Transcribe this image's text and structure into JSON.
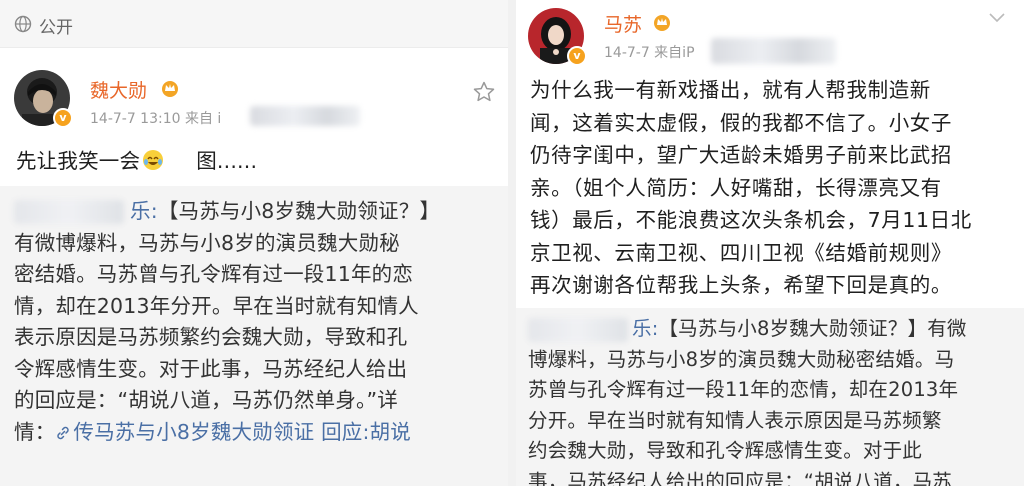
{
  "left": {
    "visibility_label": "公开",
    "visibility_icon": "globe-icon",
    "author": "魏大勋",
    "time_prefix": "14-7-7 13:10 来自 i",
    "star_icon": "star-icon",
    "post_text_a": "先让我笑一会",
    "emoji_icon": "laughing-tears-emoji",
    "post_text_b": "图......",
    "repost": {
      "source_suffix": "乐:",
      "line1_rest": "【马苏与小8岁魏大勋领证？】",
      "lines": [
        "有微博爆料，马苏与小8岁的演员魏大勋秘",
        "密结婚。马苏曾与孔令辉有过一段11年的恋",
        "情，却在2013年分开。早在当时就有知情人",
        "表示原因是马苏频繁约会魏大勋，导致和孔",
        "令辉感情生变。对于此事，马苏经纪人给出",
        "的回应是：“胡说八道，马苏仍然单身。”详"
      ],
      "last_prefix": "情：",
      "link_text": "传马苏与小8岁魏大勋领证",
      "link_tail": "回应:胡说"
    }
  },
  "right": {
    "author": "马苏",
    "time_prefix": "14-7-7  来自iP",
    "chevron_icon": "chevron-down-icon",
    "post_lines": [
      "为什么我一有新戏播出，就有人帮我制造新",
      "闻，这着实太虚假，假的我都不信了。小女子",
      "仍待字闺中，望广大适龄未婚男子前来比武招",
      "亲。（姐个人简历：人好嘴甜，长得漂亮又有",
      "钱）最后，不能浪费这次头条机会，7月11日北",
      "京卫视、云南卫视、四川卫视《结婚前规则》",
      "再次谢谢各位帮我上头条，希望下回是真的。"
    ],
    "repost": {
      "source_suffix": "乐:",
      "line1_rest": "【马苏与小8岁魏大勋领证？】有微",
      "lines": [
        "博爆料，马苏与小8岁的演员魏大勋秘密结婚。马",
        "苏曾与孔令辉有过一段11年的恋情，却在2013年",
        "分开。早在当时就有知情人表示原因是马苏频繁",
        "约会魏大勋，导致和孔令辉感情生变。对于此",
        "事，马苏经纪人给出的回应是：“胡说八道，马苏"
      ]
    }
  },
  "colors": {
    "username": "#e8672a",
    "link": "#4a6fa5",
    "verified_badge": "#f6a21e",
    "repost_bg": "#f4f4f4"
  }
}
